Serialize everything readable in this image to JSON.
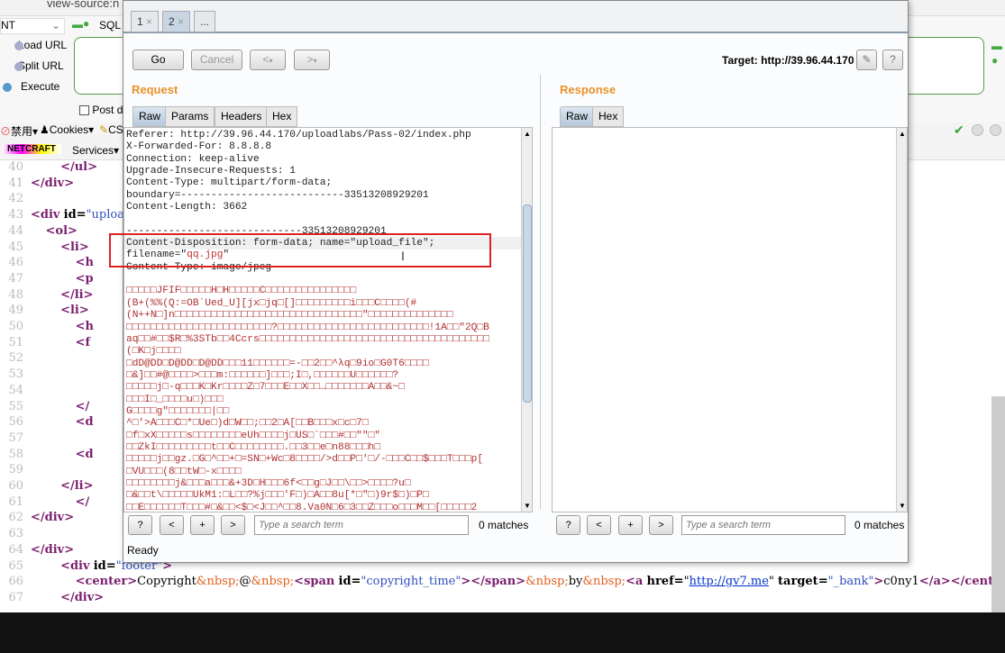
{
  "browser": {
    "address": "view-source:n",
    "hackbar": {
      "select_value": "NT",
      "sql_label": "SQL",
      "load_url": "Load URL",
      "split_url": "Split URL",
      "execute": "Execute",
      "post_data": "Post d"
    },
    "toolbar": {
      "disable": "禁用▾",
      "cookies": "Cookies▾",
      "css": "CS",
      "netcraft": "NETCRAFT",
      "services": "Services▾"
    }
  },
  "source_lines": [
    {
      "n": "40",
      "html": "        <span class='tag'>&lt;/ul&gt;</span>"
    },
    {
      "n": "41",
      "html": "<span class='tag'>&lt;/div&gt;</span>"
    },
    {
      "n": "42",
      "html": ""
    },
    {
      "n": "43",
      "html": "<span class='tag'>&lt;div</span> <span class='attr'>id=</span><span class='val'>\"uploa</span>"
    },
    {
      "n": "44",
      "html": "    <span class='tag'>&lt;ol&gt;</span>"
    },
    {
      "n": "45",
      "html": "        <span class='tag'>&lt;li&gt;</span>"
    },
    {
      "n": "46",
      "html": "            <span class='tag'>&lt;h</span>"
    },
    {
      "n": "47",
      "html": "            <span class='tag'>&lt;p</span>"
    },
    {
      "n": "48",
      "html": "        <span class='tag'>&lt;/li&gt;</span>"
    },
    {
      "n": "49",
      "html": "        <span class='tag'>&lt;li&gt;</span>"
    },
    {
      "n": "50",
      "html": "            <span class='tag'>&lt;h</span>"
    },
    {
      "n": "51",
      "html": "            <span class='tag'>&lt;f</span>"
    },
    {
      "n": "52",
      "html": ""
    },
    {
      "n": "53",
      "html": ""
    },
    {
      "n": "54",
      "html": ""
    },
    {
      "n": "55",
      "html": "            <span class='tag'>&lt;/</span>"
    },
    {
      "n": "56",
      "html": "            <span class='tag'>&lt;d</span>"
    },
    {
      "n": "57",
      "html": ""
    },
    {
      "n": "58",
      "html": "            <span class='tag'>&lt;d</span>"
    },
    {
      "n": "59",
      "html": ""
    },
    {
      "n": "60",
      "html": "        <span class='tag'>&lt;/li&gt;</span>"
    },
    {
      "n": "61",
      "html": "            <span class='tag'>&lt;/</span>"
    },
    {
      "n": "62",
      "html": "<span class='tag'>&lt;/div&gt;</span>"
    },
    {
      "n": "63",
      "html": ""
    },
    {
      "n": "64",
      "html": "<span class='tag'>&lt;/div&gt;</span>"
    },
    {
      "n": "65",
      "html": "        <span class='tag'>&lt;div</span> <span class='attr'>id=</span><span class='val'>\"footer\"</span><span class='tag'>&gt;</span>"
    },
    {
      "n": "66",
      "html": "            <span class='tag'>&lt;center&gt;</span>Copyright<span class='ent'>&amp;nbsp;</span>@<span class='ent'>&amp;nbsp;</span><span class='tag'>&lt;span</span> <span class='attr'>id=</span><span class='val'>\"copyright_time\"</span><span class='tag'>&gt;&lt;/span&gt;</span><span class='ent'>&amp;nbsp;</span>by<span class='ent'>&amp;nbsp;</span><span class='tag'>&lt;a</span> <span class='attr'>href=</span>\"<span class='lnk'>http://gv7.me</span>\" <span class='attr'>target=</span><span class='val'>\"_bank\"</span><span class='tag'>&gt;</span>c0ny1<span class='tag'>&lt;/a&gt;&lt;/center&gt;</span>"
    },
    {
      "n": "67",
      "html": "        <span class='tag'>&lt;/div&gt;</span>"
    }
  ],
  "repeater": {
    "tabs": [
      {
        "label": "1",
        "close": "×"
      },
      {
        "label": "2",
        "close": "×"
      },
      {
        "label": "..."
      }
    ],
    "go": "Go",
    "cancel": "Cancel",
    "back": "<",
    "forward": ">",
    "dropdown": "▾",
    "target": "Target: http://39.96.44.170",
    "edit_icon": "pencil-icon",
    "help": "?",
    "request": {
      "title": "Request",
      "tabs": [
        "Raw",
        "Params",
        "Headers",
        "Hex"
      ],
      "headers": [
        "Referer: http://39.96.44.170/uploadlabs/Pass-02/index.php",
        "X-Forwarded-For: 8.8.8.8",
        "Connection: keep-alive",
        "Upgrade-Insecure-Requests: 1",
        "Content-Type: multipart/form-data;",
        "boundary=---------------------------33513208929201",
        "Content-Length: 3662",
        "",
        "-----------------------------33513208929201",
        "Content-Disposition: form-data; name=\"upload_file\";"
      ],
      "filename_prefix": "filename=\"",
      "filename_value": "qq.jpg",
      "filename_suffix": "\"",
      "content_type": "Content-Type: image/jpeg",
      "binary": [
        "□□□□□JFIF□□□□□H□H□□□□□C□□□□□□□□□□□□□□□",
        "(B+(%%(Q:=OB`Ued_U][jx□jq□[]□□□□□□□□□i□□□C□□□□(#",
        "(N++N□]n□□□□□□□□□□□□□□□□□□□□□□□□□□□□□□□\"□□□□□□□□□□□□□□",
        "□□□□□□□□□□□□□□□□□□□□□□□□?□□□□□□□□□□□□□□□□□□□□□□□□□!1A□□\"2Q□B",
        "aq□□#□□$R□%3STb□□4Ccrs□□□□□□□□□□□□□□□□□□□□□□□□□□□□□□□□□□□□□□",
        "(□K□j□□□□",
        "□dD@DD□D@DD□D@DD□□□11□□□□□□=-□□2□□^λq□9io□G0T6□□□□",
        "□&]□□#@□□□□>□□□m:□□□□□□]□□□;I□,□□□□□□U□□□□□□?",
        "□□□□□j□-q□□□K□Kr□□□□Z□7□□□E□□X□□…□□□□□□□A□□&~□",
        "□□□I□_□□□□u□)□□□",
        "G□□□□g\"□□□□□□□|□□",
        "^□'>A□□□C□*□Ue□)d□W□□;□□2□A[□□B□□□x□c□7□",
        "□f□xX□□□□□s□□□□□□□□eUh□□□□j□US□`□□□#□□\"\"□\"",
        "□□ZkI□□□□□□□□□t□□C□□□□□□□□.□□3□□e□n88□□□h□",
        "□□□□□j□□gz.□G□^□□+□=SN□+Wc□8□□□□/>d□□P□'□/-□□□C□□$□□□T□□□p[",
        "□VU□□□(8□□tW□-x□□□□",
        "□□□□□□□□j&□□□a□□□&+3D□H□□□6f<□□g□J□□\\□□>□□□□?u□",
        "□&□□t\\□□□□□UkM1:□L□□?%j□□□'F□)□A□□8u[*□\"□)9r$□)□P□",
        "□□E□□□□□□T□□□#□&□□<$□<J□□^□□8.Va0N□6□3□□Z□□□o□□□M□□[□□□□□2"
      ],
      "search_placeholder": "Type a search term",
      "matches": "0 matches"
    },
    "response": {
      "title": "Response",
      "tabs": [
        "Raw",
        "Hex"
      ],
      "search_placeholder": "Type a search term",
      "matches": "0 matches"
    },
    "search_buttons": [
      "?",
      "<",
      "+",
      ">"
    ],
    "status": "Ready"
  },
  "colors": {
    "accent": "#e8922a",
    "highlight_box": "#e02020",
    "binary_text": "#b03030"
  }
}
